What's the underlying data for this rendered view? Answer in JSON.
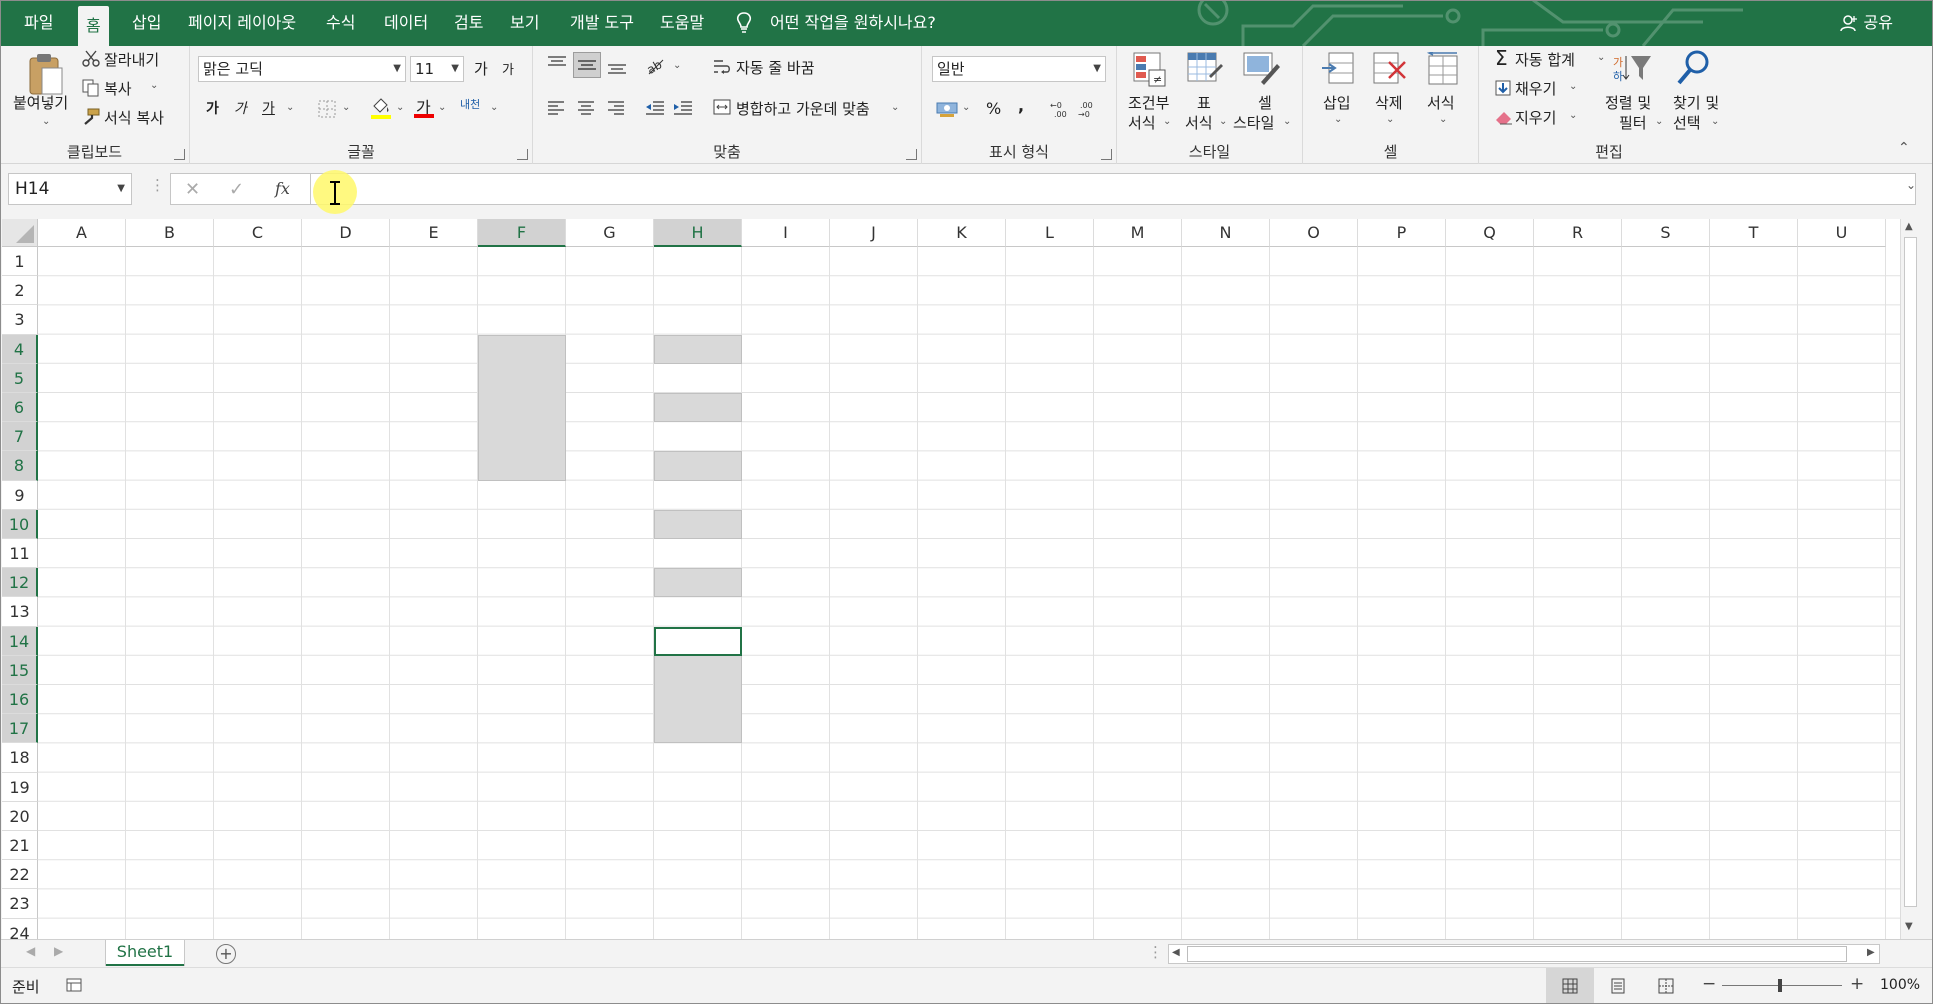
{
  "menubar": {
    "tabs": [
      "파일",
      "홈",
      "삽입",
      "페이지 레이아웃",
      "수식",
      "데이터",
      "검토",
      "보기",
      "개발 도구",
      "도움말"
    ],
    "active_tab": "홈",
    "tell_me": "어떤 작업을 원하시나요?",
    "share": "공유"
  },
  "ribbon": {
    "clipboard": {
      "label": "클립보드",
      "paste": "붙여넣기",
      "cut": "잘라내기",
      "copy": "복사",
      "format_painter": "서식 복사"
    },
    "font": {
      "label": "글꼴",
      "font_name": "맑은 고딕",
      "font_size": "11",
      "grow": "가",
      "shrink": "가",
      "bold": "가",
      "italic": "가",
      "underline": "가",
      "font_color_glyph": "가",
      "phonetic": "내천"
    },
    "alignment": {
      "label": "맞춤",
      "wrap_text": "자동 줄 바꿈",
      "merge_center": "병합하고 가운데 맞춤"
    },
    "number": {
      "label": "표시 형식",
      "format": "일반",
      "percent": "%",
      "comma": ","
    },
    "styles": {
      "label": "스타일",
      "conditional_1": "조건부",
      "conditional_2": "서식",
      "table_1": "표",
      "table_2": "서식",
      "cell_1": "셀",
      "cell_2": "스타일"
    },
    "cells": {
      "label": "셀",
      "insert": "삽입",
      "delete": "삭제",
      "format": "서식"
    },
    "editing": {
      "label": "편집",
      "autosum": "자동 합계",
      "fill": "채우기",
      "clear": "지우기",
      "sort_1": "정렬 및",
      "sort_2": "필터",
      "find_1": "찾기 및",
      "find_2": "선택"
    }
  },
  "formula_bar": {
    "name_box": "H14",
    "cancel": "✕",
    "enter": "✓",
    "fx": "fx",
    "formula": ""
  },
  "grid": {
    "columns": [
      "A",
      "B",
      "C",
      "D",
      "E",
      "F",
      "G",
      "H",
      "I",
      "J",
      "K",
      "L",
      "M",
      "N",
      "O",
      "P",
      "Q",
      "R",
      "S",
      "T",
      "U"
    ],
    "rows": [
      "1",
      "2",
      "3",
      "4",
      "5",
      "6",
      "7",
      "8",
      "9",
      "10",
      "11",
      "12",
      "13",
      "14",
      "15",
      "16",
      "17",
      "18",
      "19",
      "20",
      "21",
      "22",
      "23",
      "24"
    ],
    "selected_columns": [
      "F",
      "H"
    ],
    "selected_rows": [
      "4",
      "5",
      "6",
      "7",
      "8",
      "10",
      "12",
      "14",
      "15",
      "16",
      "17"
    ],
    "active_cell": "H14",
    "selection_ranges": [
      "F4:F8",
      "H4",
      "H6",
      "H8",
      "H10",
      "H12",
      "H14:H17"
    ],
    "selection_color": "#d9d9d9",
    "accent_color": "#217346"
  },
  "sheets": {
    "tabs": [
      "Sheet1"
    ],
    "active": "Sheet1",
    "add_icon": "plus-circle-icon"
  },
  "status": {
    "mode": "준비",
    "zoom": "100%"
  }
}
